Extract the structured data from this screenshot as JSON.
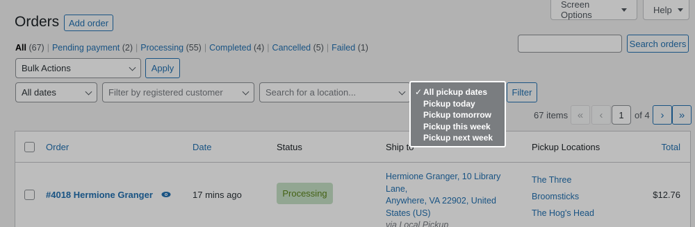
{
  "screen_options": {
    "screen_options_label": "Screen Options",
    "help_label": "Help"
  },
  "header": {
    "title": "Orders",
    "add_order_label": "Add order"
  },
  "status_filters": [
    {
      "label": "All",
      "count": "(67)"
    },
    {
      "label": "Pending payment",
      "count": "(2)"
    },
    {
      "label": "Processing",
      "count": "(55)"
    },
    {
      "label": "Completed",
      "count": "(4)"
    },
    {
      "label": "Cancelled",
      "count": "(5)"
    },
    {
      "label": "Failed",
      "count": "(1)"
    }
  ],
  "search": {
    "button_label": "Search orders",
    "value": ""
  },
  "bulk": {
    "selected": "Bulk Actions",
    "apply_label": "Apply"
  },
  "filters": {
    "dates_selected": "All dates",
    "customer_placeholder": "Filter by registered customer",
    "location_placeholder": "Search for a location...",
    "filter_label": "Filter"
  },
  "pickup_dropdown": {
    "selected_index": 0,
    "options": [
      "All pickup dates",
      "Pickup today",
      "Pickup tomorrow",
      "Pickup this week",
      "Pickup next week"
    ]
  },
  "pagination": {
    "items_count": "67 items",
    "first": "«",
    "prev": "‹",
    "current_page": "1",
    "of_label": "of 4",
    "next": "›",
    "last": "»"
  },
  "table": {
    "columns": {
      "order": "Order",
      "date": "Date",
      "status": "Status",
      "ship_to": "Ship to",
      "pickup_locations": "Pickup Locations",
      "total": "Total"
    },
    "rows": [
      {
        "order": "#4018 Hermione Granger",
        "date": "17 mins ago",
        "status": "Processing",
        "ship_to_line1": "Hermione Granger, 10 Library Lane,",
        "ship_to_line2": "Anywhere, VA 22902, United",
        "ship_to_line3": "States (US)",
        "ship_via": "via Local Pickup",
        "pickup_locations": [
          "The Three",
          "Broomsticks",
          "The Hog's Head"
        ],
        "total": "$12.76"
      }
    ]
  },
  "colors": {
    "accent": "#2271b1",
    "processing_bg": "#c6e1c6",
    "processing_text": "#5b841b"
  }
}
